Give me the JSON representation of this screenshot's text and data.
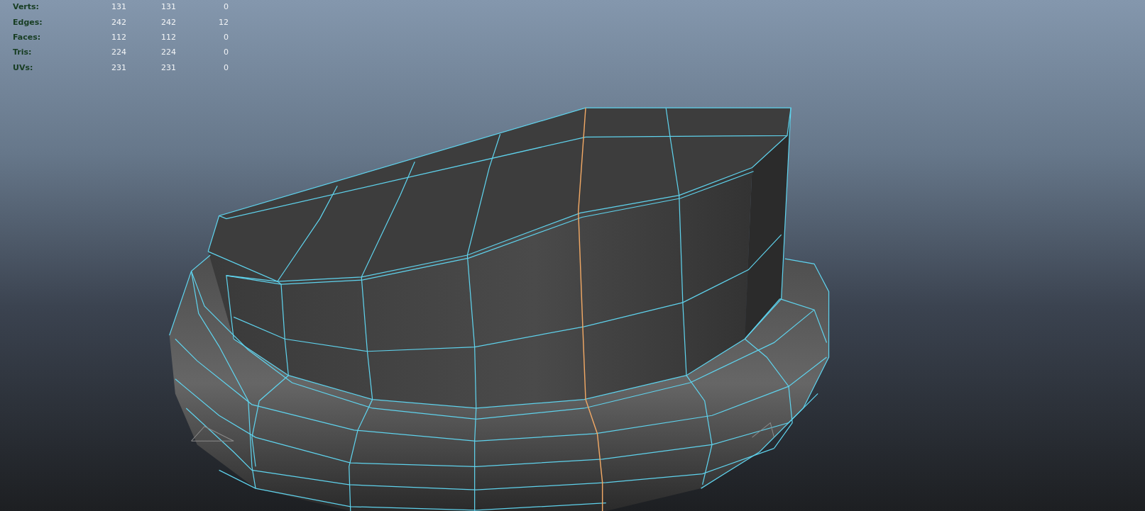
{
  "viewport": {
    "hud_stats": [
      {
        "label": "Verts:",
        "values": [
          "131",
          "131",
          "0"
        ]
      },
      {
        "label": "Edges:",
        "values": [
          "242",
          "242",
          "12"
        ]
      },
      {
        "label": "Faces:",
        "values": [
          "112",
          "112",
          "0"
        ]
      },
      {
        "label": "Tris:",
        "values": [
          "224",
          "224",
          "0"
        ]
      },
      {
        "label": "UVs:",
        "values": [
          "231",
          "231",
          "0"
        ]
      }
    ]
  }
}
